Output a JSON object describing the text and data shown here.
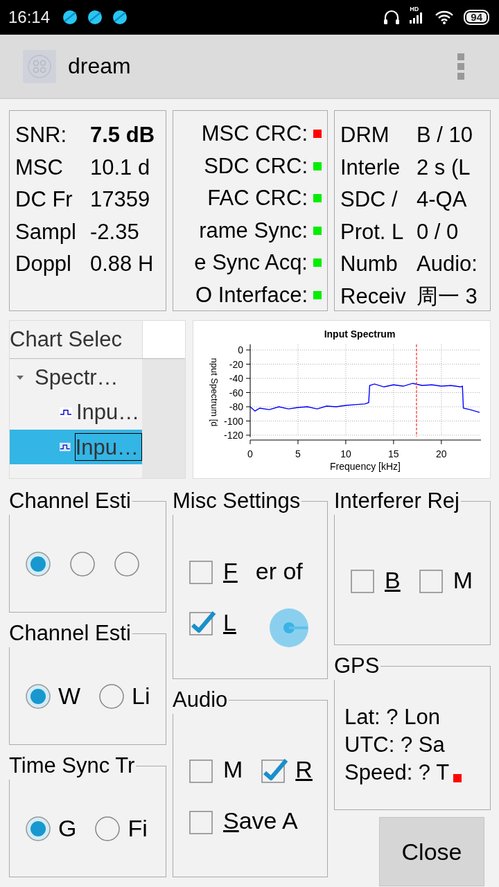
{
  "status_bar": {
    "time": "16:14",
    "network": "HD",
    "battery": "94"
  },
  "app_bar": {
    "title": "dream"
  },
  "info_panels": [
    {
      "kind": "values",
      "rows": [
        {
          "label": "SNR:",
          "value": "7.5 dB",
          "bold": true
        },
        {
          "label": "MSC",
          "value": "10.1 d",
          "bold": false
        },
        {
          "label": "DC Fr",
          "value": "17359",
          "bold": false
        },
        {
          "label": "Sampl",
          "value": "-2.35",
          "bold": false
        },
        {
          "label": "Doppl",
          "value": "0.88 H",
          "bold": false
        }
      ]
    },
    {
      "kind": "status",
      "rows": [
        {
          "label": "MSC CRC:",
          "color": "#ff0000"
        },
        {
          "label": "SDC CRC:",
          "color": "#00ee00"
        },
        {
          "label": "FAC CRC:",
          "color": "#00ee00"
        },
        {
          "label": "rame Sync:",
          "color": "#00ee00"
        },
        {
          "label": "e Sync Acq:",
          "color": "#00ee00"
        },
        {
          "label": "O Interface:",
          "color": "#00ee00"
        }
      ]
    },
    {
      "kind": "values",
      "rows": [
        {
          "label": "DRM",
          "value": "B / 10"
        },
        {
          "label": "Interle",
          "value": "2 s (L"
        },
        {
          "label": "SDC /",
          "value": "4-QA"
        },
        {
          "label": "Prot. L",
          "value": "0 / 0"
        },
        {
          "label": "Numb",
          "value": "Audio:"
        },
        {
          "label": "Receiv",
          "value": "周一 3"
        }
      ]
    }
  ],
  "chart_selector": {
    "header": "Chart Selec",
    "items": [
      {
        "label": "Spectr…",
        "expanded": true,
        "children": [
          {
            "label": "Inpu…",
            "selected": false
          },
          {
            "label": "Inpu…",
            "selected": true
          }
        ]
      }
    ]
  },
  "chart": {
    "chart_data": {
      "type": "line",
      "title": "Input Spectrum",
      "xlabel": "Frequency [kHz]",
      "ylabel": "nput Spectrum [d",
      "x": [
        0,
        0.5,
        1,
        2,
        3,
        4,
        5,
        6,
        7,
        8,
        9,
        10,
        11,
        12,
        12.4,
        12.5,
        13,
        14,
        15,
        16,
        17,
        18,
        19,
        20,
        21,
        22,
        22.2,
        22.3,
        23,
        24
      ],
      "series": [
        {
          "color": "#0000ff",
          "values": [
            -80,
            -86,
            -82,
            -84,
            -80,
            -83,
            -81,
            -80,
            -83,
            -79,
            -80,
            -78,
            -77,
            -76,
            -74,
            -50,
            -48,
            -52,
            -49,
            -51,
            -47,
            -50,
            -49,
            -51,
            -50,
            -52,
            -51,
            -82,
            -84,
            -88
          ]
        }
      ],
      "xlim": [
        0,
        24
      ],
      "ylim": [
        -120,
        0
      ],
      "xticks": [
        0,
        5,
        10,
        15,
        20
      ],
      "yticks": [
        0,
        -20,
        -40,
        -60,
        -80,
        -100,
        -120
      ],
      "grid": true,
      "ref_lines": [
        {
          "axis": "x",
          "value": 17.4,
          "color": "#ff0000"
        }
      ]
    }
  },
  "settings_columns": [
    {
      "groups": [
        {
          "title": "Channel Esti",
          "rows": [
            [
              {
                "kind": "radio",
                "selected": true
              },
              {
                "kind": "radio",
                "selected": false
              },
              {
                "kind": "radio",
                "selected": false
              }
            ]
          ]
        },
        {
          "title": "Channel Esti",
          "rows": [
            [
              {
                "kind": "radio",
                "label": "W",
                "selected": true
              },
              {
                "kind": "radio",
                "label": "Li",
                "selected": false
              }
            ]
          ]
        },
        {
          "title": "Time Sync Tr",
          "rows": [
            [
              {
                "kind": "radio",
                "label": "G",
                "selected": true
              },
              {
                "kind": "radio",
                "label": "Fi",
                "selected": false
              }
            ]
          ]
        }
      ]
    },
    {
      "groups": [
        {
          "title": "Misc Settings",
          "rows": [
            [
              {
                "kind": "checkbox",
                "label": "F",
                "mnemonic": true,
                "checked": false
              },
              {
                "kind": "text",
                "label": "er of"
              }
            ],
            [
              {
                "kind": "checkbox",
                "label": "L",
                "mnemonic": true,
                "checked": true
              }
            ]
          ]
        },
        {
          "title": "Audio",
          "rows": [
            [
              {
                "kind": "checkbox",
                "label": "M",
                "mnemonic": false,
                "checked": false
              },
              {
                "kind": "checkbox",
                "label": "R",
                "mnemonic": true,
                "checked": true
              }
            ],
            [
              {
                "kind": "checkbox",
                "label": "Save A",
                "mnemonic": true,
                "checked": false
              }
            ]
          ]
        }
      ]
    },
    {
      "groups": [
        {
          "title": "Interferer Rej",
          "rows": [
            [
              {
                "kind": "checkbox",
                "label": "B",
                "mnemonic": true,
                "checked": false
              },
              {
                "kind": "checkbox",
                "label": "M",
                "mnemonic": false,
                "checked": false
              }
            ]
          ]
        },
        {
          "title": "GPS",
          "rows": [
            [
              {
                "kind": "text",
                "label": "Lat: ?  Lon"
              }
            ],
            [
              {
                "kind": "text",
                "label": "UTC: ?  Sa"
              }
            ],
            [
              {
                "kind": "text",
                "label": "Speed: ?  T"
              },
              {
                "kind": "dot",
                "color": "#ff0000"
              }
            ]
          ]
        }
      ],
      "button": "Close"
    }
  ]
}
